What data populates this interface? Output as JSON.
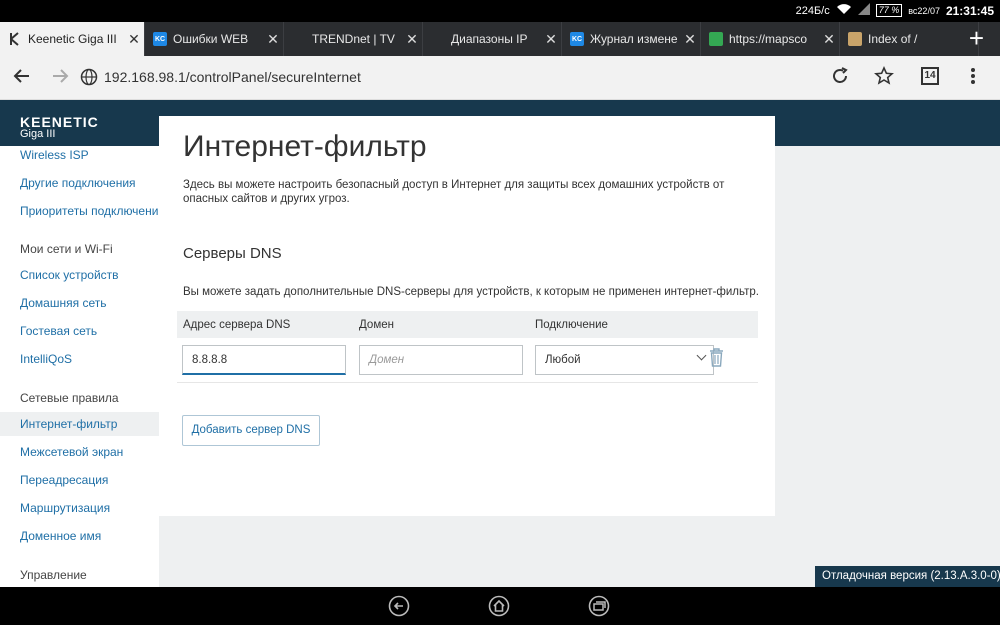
{
  "status_bar": {
    "speed": "224Б/с",
    "battery": "77 %",
    "date": "вс22/07",
    "time": "21:31:45"
  },
  "tabs": [
    {
      "title": "Keenetic Giga III",
      "favicon": "keenetic-icon",
      "active": true
    },
    {
      "title": "Ошибки WEB",
      "favicon": "kc-icon"
    },
    {
      "title": "TRENDnet | TV",
      "favicon": ""
    },
    {
      "title": "Диапазоны IP",
      "favicon": ""
    },
    {
      "title": "Журнал измене",
      "favicon": "kc-icon"
    },
    {
      "title": "https://mapsco",
      "favicon": "maps-icon"
    },
    {
      "title": "Index of /",
      "favicon": "page-icon"
    }
  ],
  "new_tab_label": "+",
  "browser": {
    "url": "192.168.98.1/controlPanel/secureInternet",
    "tab_count": "14"
  },
  "app": {
    "logo": "KEENETIC",
    "model": "Giga III"
  },
  "sidebar": {
    "items_top": [
      "Wireless ISP",
      "Другие подключения",
      "Приоритеты подключений"
    ],
    "section_networks": "Мои сети и Wi-Fi",
    "items_networks": [
      "Список устройств",
      "Домашняя сеть",
      "Гостевая сеть",
      "IntelliQoS"
    ],
    "section_rules": "Сетевые правила",
    "items_rules": [
      "Интернет-фильтр",
      "Межсетевой экран",
      "Переадресация",
      "Маршрутизация",
      "Доменное имя"
    ],
    "section_manage": "Управление"
  },
  "main": {
    "title": "Интернет-фильтр",
    "description": "Здесь вы можете настроить безопасный доступ в Интернет для защиты всех домашних устройств от опасных сайтов и других угроз.",
    "dns_title": "Серверы DNS",
    "dns_description": "Вы можете задать дополнительные DNS-серверы для устройств, к которым не применен интернет-фильтр.",
    "columns": [
      "Адрес сервера DNS",
      "Домен",
      "Подключение"
    ],
    "row": {
      "dns_address": "8.8.8.8",
      "domain_placeholder": "Домен",
      "connection": "Любой"
    },
    "add_button": "Добавить сервер DNS"
  },
  "debug_label": "Отладочная версия (2.13.A.3.0-0)",
  "colors": {
    "accent": "#1f6fa6",
    "header_band": "#17384d"
  }
}
